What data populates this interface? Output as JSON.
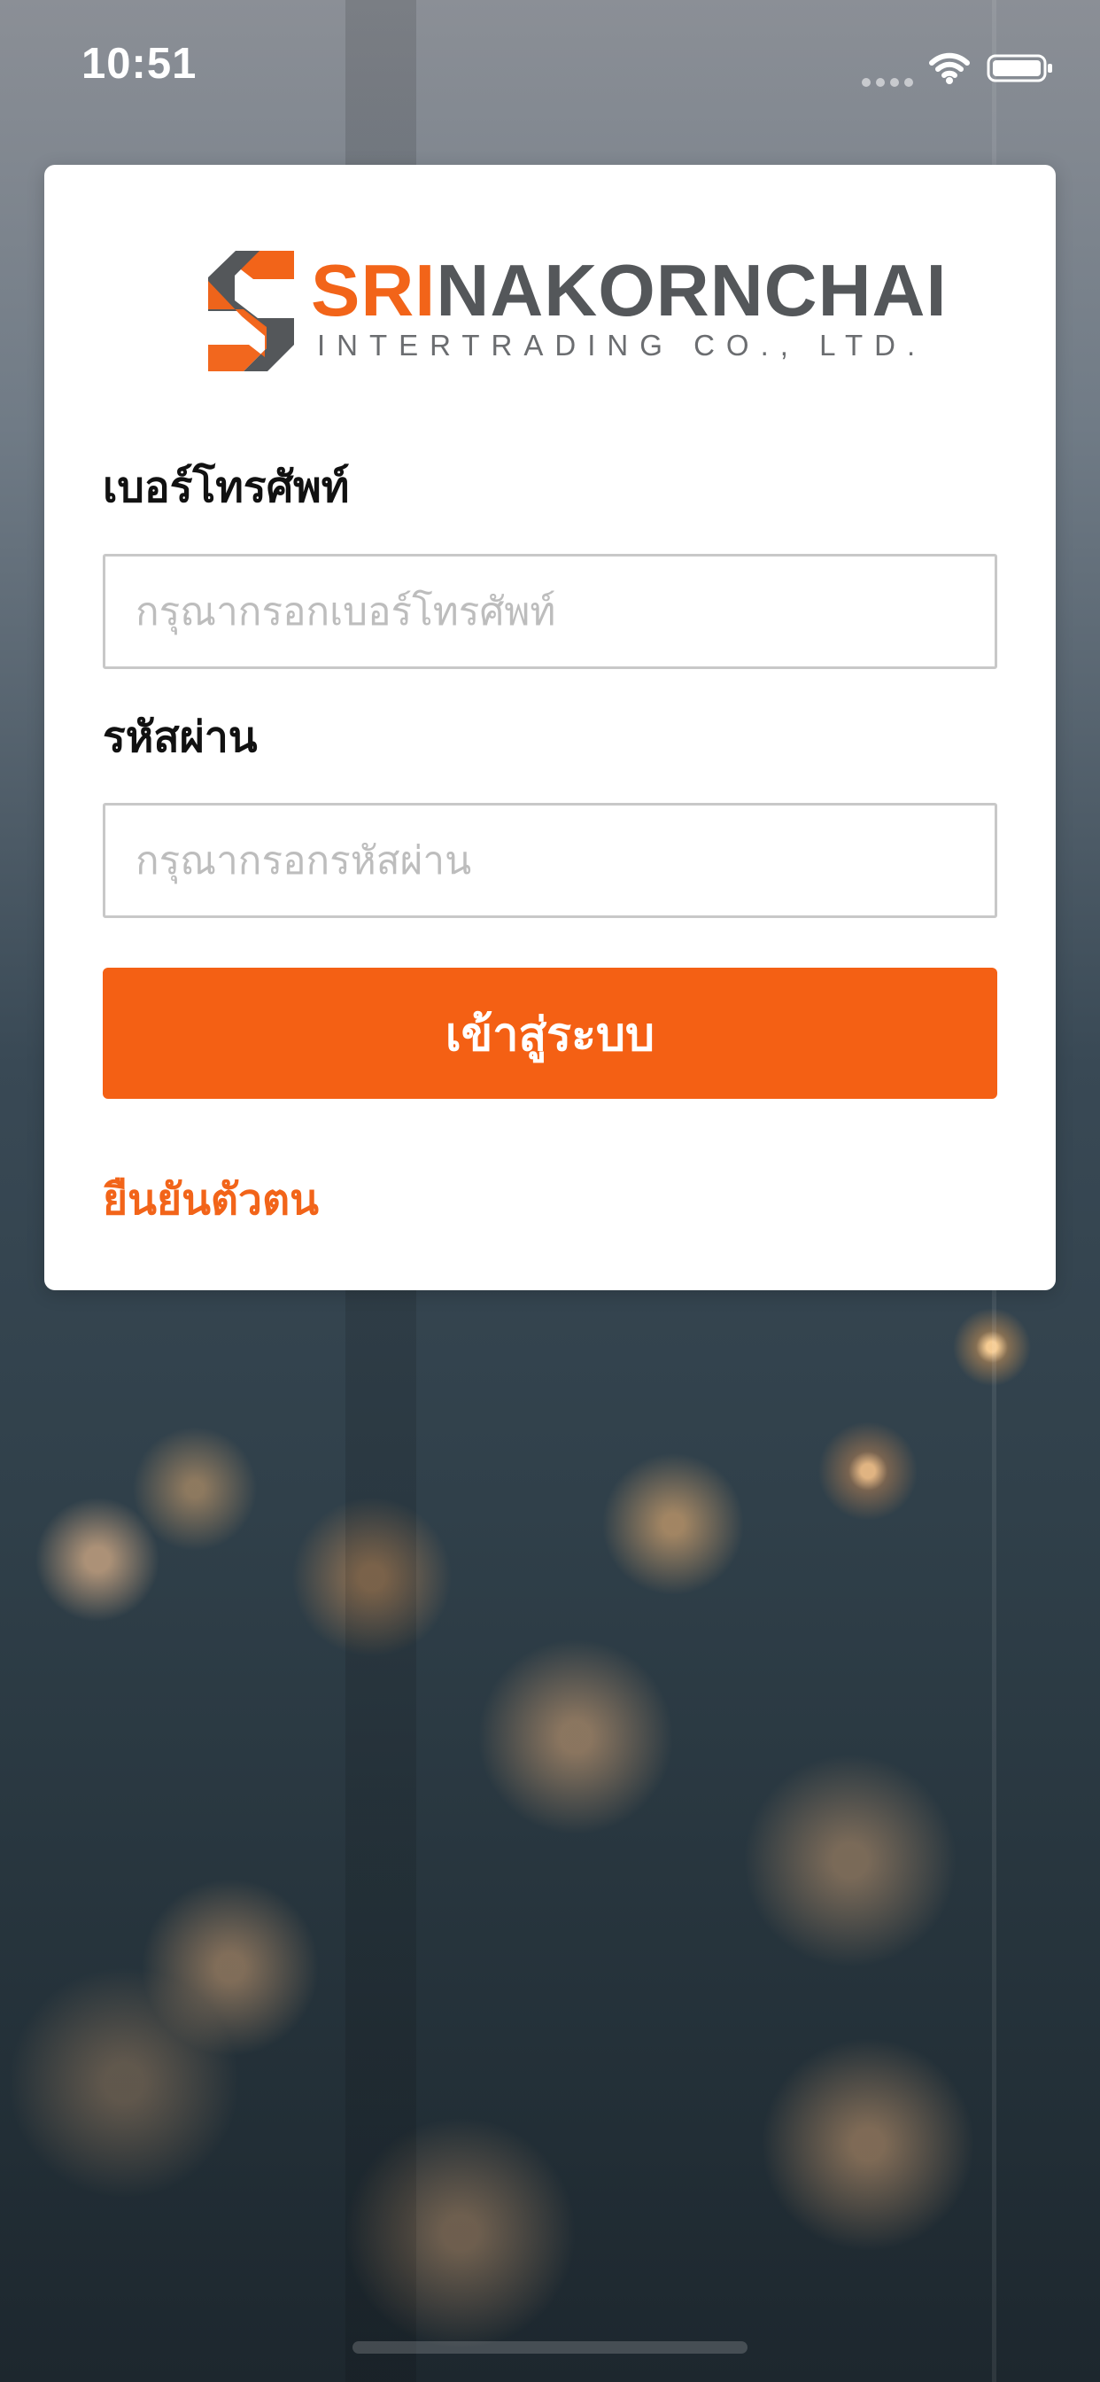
{
  "status_bar": {
    "time": "10:51",
    "signal_icon": "signal-dots-icon",
    "wifi_icon": "wifi-icon",
    "battery_icon": "battery-icon"
  },
  "brand": {
    "name_accent": "SRI",
    "name_rest": "NAKORNCHAI",
    "subtitle": "INTERTRADING CO., LTD.",
    "logo_icon": "s-logo-icon",
    "accent_color": "#f26419",
    "text_color": "#54575a"
  },
  "form": {
    "phone_label": "เบอร์โทรศัพท์",
    "phone_placeholder": "กรุณากรอกเบอร์โทรศัพท์",
    "password_label": "รหัสผ่าน",
    "password_placeholder": "กรุณากรอกรหัสผ่าน",
    "login_button": "เข้าสู่ระบบ",
    "verify_link": "ยืนยันตัวตน"
  }
}
